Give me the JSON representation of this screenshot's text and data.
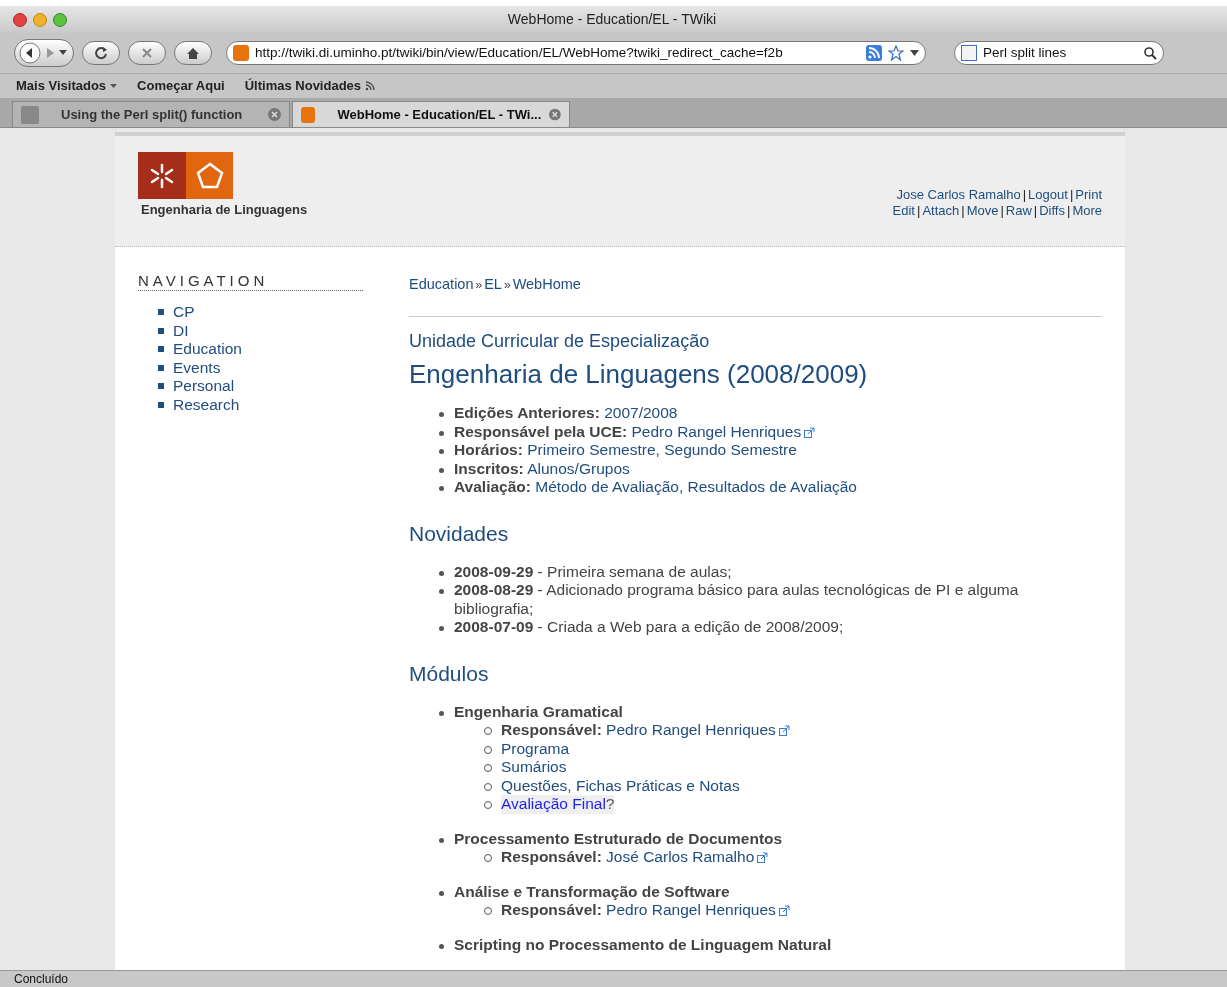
{
  "window": {
    "title": "WebHome - Education/EL - TWiki"
  },
  "toolbar": {
    "url": "http://twiki.di.uminho.pt/twiki/bin/view/Education/EL/WebHome?twiki_redirect_cache=f2b",
    "search_value": "Perl split lines"
  },
  "bookmarks": [
    {
      "label": "Mais Visitados",
      "kind": "menu"
    },
    {
      "label": "Começar Aqui",
      "kind": "plain"
    },
    {
      "label": "Últimas Novidades",
      "kind": "feed"
    }
  ],
  "tabs": [
    {
      "label": "Using the Perl split() function",
      "selected": false
    },
    {
      "label": "WebHome - Education/EL - TWi...",
      "selected": true
    }
  ],
  "site": {
    "logo_text": "Engenharia de Linguagens",
    "user_links": [
      [
        {
          "label": "Jose Carlos Ramalho",
          "sep": "|"
        },
        {
          "label": "Logout",
          "sep": "|"
        },
        {
          "label": "Print"
        }
      ],
      [
        {
          "label": "Edit",
          "sep": "|"
        },
        {
          "label": "Attach",
          "sep": "|"
        },
        {
          "label": "Move",
          "sep": "|"
        },
        {
          "label": "Raw",
          "sep": "|"
        },
        {
          "label": "Diffs",
          "sep": "|"
        },
        {
          "label": "More"
        }
      ]
    ]
  },
  "navigation": {
    "title": "NAVIGATION",
    "items": [
      "CP",
      "DI",
      "Education",
      "Events",
      "Personal",
      "Research"
    ]
  },
  "breadcrumb": [
    {
      "label": "Education",
      "sep": "»"
    },
    {
      "label": "EL",
      "sep": "»"
    },
    {
      "label": "WebHome"
    }
  ],
  "subtitle": "Unidade Curricular de Especialização",
  "title": "Engenharia de Linguagens (2008/2009)",
  "info": [
    {
      "label": "Edições Anteriores:",
      "value": "2007/2008",
      "external": false
    },
    {
      "label": "Responsável pela UCE:",
      "value": "Pedro Rangel Henriques",
      "external": true
    },
    {
      "label": "Horários:",
      "value": "Primeiro Semestre, Segundo Semestre",
      "external": false
    },
    {
      "label": "Inscritos:",
      "value": "Alunos/Grupos",
      "external": false
    },
    {
      "label": "Avaliação:",
      "value": "Método de Avaliação, Resultados de Avaliação",
      "external": false
    }
  ],
  "news_heading": "Novidades",
  "news": [
    {
      "date": "2008-09-29",
      "text": "- Primeira semana de aulas;"
    },
    {
      "date": "2008-08-29",
      "text": "- Adicionado programa básico para aulas tecnológicas de PI e alguma bibliografia;"
    },
    {
      "date": "2008-07-09",
      "text": "- Criada a Web para a edição de 2008/2009;"
    }
  ],
  "modules_heading": "Módulos",
  "modules": [
    {
      "title": "Engenharia Gramatical",
      "children": [
        {
          "kind": "person",
          "label": "Responsável:",
          "value": "Pedro Rangel Henriques",
          "external": true
        },
        {
          "kind": "link",
          "value": "Programa"
        },
        {
          "kind": "link",
          "value": "Sumários"
        },
        {
          "kind": "link",
          "value": "Questões, Fichas Práticas e Notas"
        },
        {
          "kind": "missing",
          "value": "Avaliação Final",
          "mark": "?"
        }
      ]
    },
    {
      "title": "Processamento Estruturado de Documentos",
      "children": [
        {
          "kind": "person",
          "label": "Responsável:",
          "value": "José Carlos Ramalho",
          "external": true
        }
      ]
    },
    {
      "title": "Análise e Transformação de Software",
      "children": [
        {
          "kind": "person",
          "label": "Responsável:",
          "value": "Pedro Rangel Henriques",
          "external": true
        }
      ]
    },
    {
      "title": "Scripting no Processamento de Linguagem Natural"
    }
  ],
  "status_bar": "Concluído"
}
